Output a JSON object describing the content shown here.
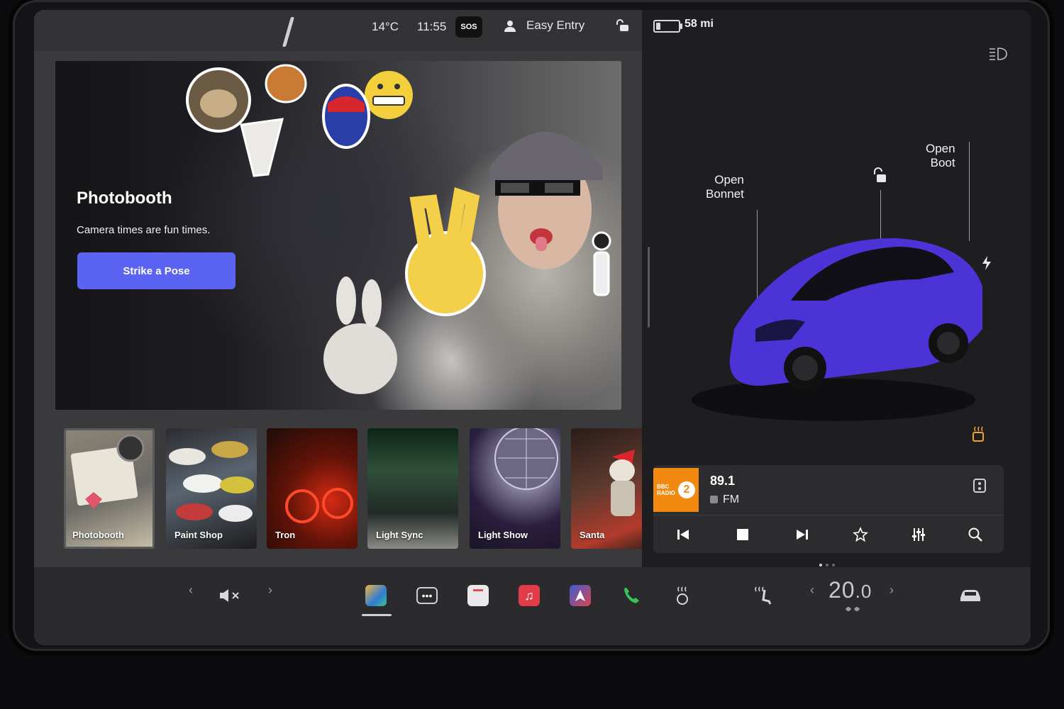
{
  "status_bar": {
    "temperature": "14°C",
    "time": "11:55",
    "sos": "SOS",
    "driver_profile": "Easy Entry"
  },
  "vehicle": {
    "range": "58 mi",
    "hints": {
      "open_bonnet": "Open\nBonnet",
      "open_boot": "Open\nBoot"
    },
    "paint_color": "#4b33d6"
  },
  "photobooth": {
    "title": "Photobooth",
    "subtitle": "Camera times are fun times.",
    "cta_label": "Strike a Pose"
  },
  "toybox_tiles": [
    {
      "label": "Photobooth",
      "selected": true
    },
    {
      "label": "Paint Shop",
      "selected": false
    },
    {
      "label": "Tron",
      "selected": false
    },
    {
      "label": "Light Sync",
      "selected": false
    },
    {
      "label": "Light Show",
      "selected": false
    },
    {
      "label": "Santa",
      "selected": false
    }
  ],
  "media": {
    "station_logo_text": "BBC\nRADIO",
    "station_number": "2",
    "frequency": "89.1",
    "band": "FM",
    "accent_color": "#f28a12"
  },
  "dock": {
    "icons": [
      "volume-mute-icon",
      "toybox-icon",
      "more-apps-icon",
      "calendar-icon",
      "music-icon",
      "navigation-icon",
      "phone-icon",
      "seat-heater-icon",
      "heated-seat-icon",
      "car-icon"
    ],
    "climate": {
      "temp_whole": "20",
      "temp_decimal": ".0"
    }
  },
  "colors": {
    "accent_button": "#5b63f2",
    "phone_green": "#37c25a",
    "music_red": "#e23b4a",
    "heat_orange": "#f0a22e"
  }
}
